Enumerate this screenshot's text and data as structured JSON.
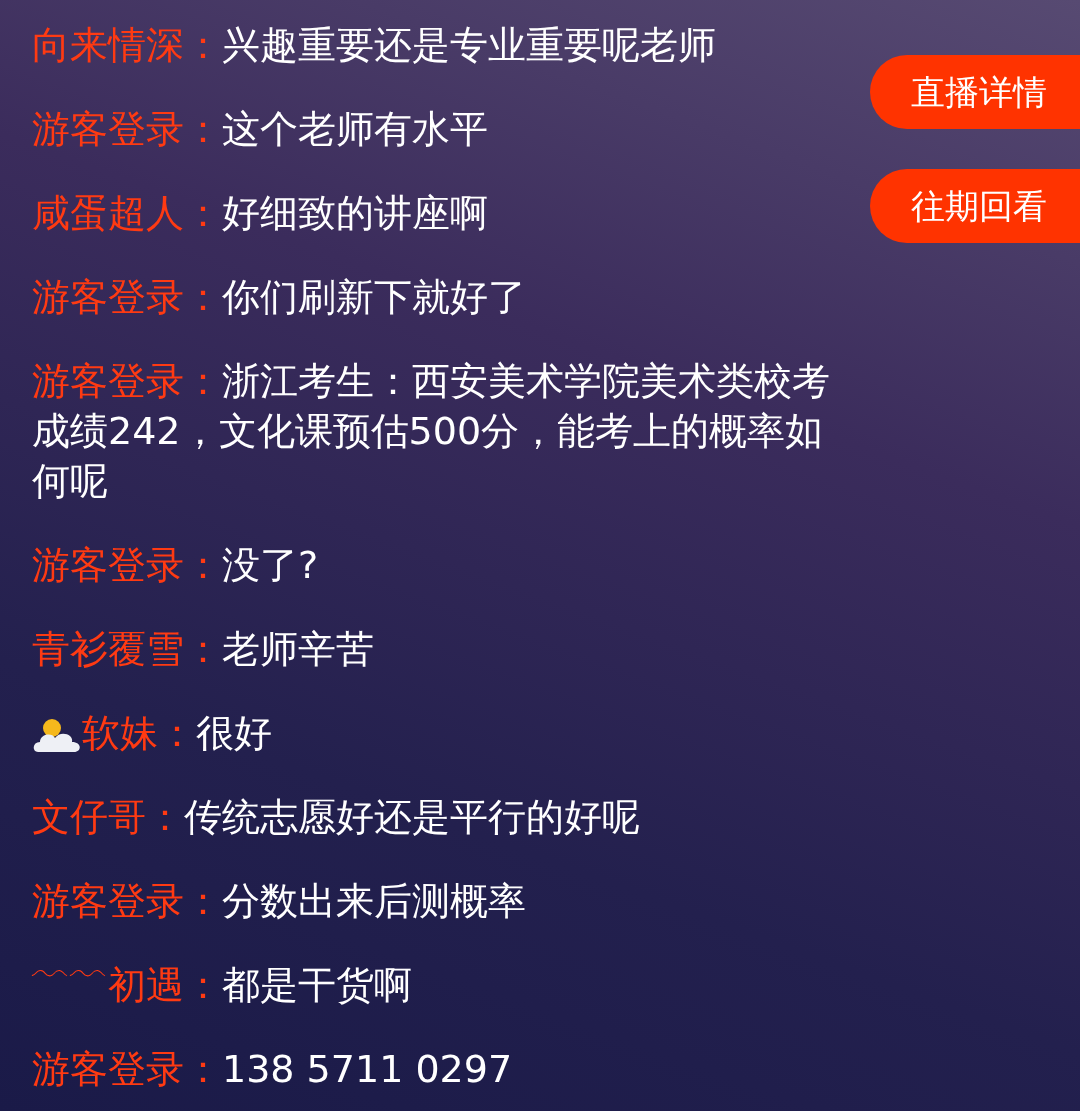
{
  "messages": [
    {
      "user": "向来情深：",
      "text": "兴趣重要还是专业重要呢老师",
      "has_icon": false
    },
    {
      "user": "游客登录：",
      "text": "这个老师有水平",
      "has_icon": false
    },
    {
      "user": "咸蛋超人：",
      "text": "好细致的讲座啊",
      "has_icon": false
    },
    {
      "user": "游客登录：",
      "text": "你们刷新下就好了",
      "has_icon": false
    },
    {
      "user": "游客登录：",
      "text": "浙江考生：西安美术学院美术类校考成绩242，文化课预估500分，能考上的概率如何呢",
      "has_icon": false
    },
    {
      "user": "游客登录：",
      "text": "没了?",
      "has_icon": false
    },
    {
      "user": "青衫覆雪：",
      "text": "老师辛苦",
      "has_icon": false
    },
    {
      "user": "软妹：",
      "text": "很好",
      "has_icon": true
    },
    {
      "user": "文仔哥：",
      "text": "传统志愿好还是平行的好呢",
      "has_icon": false
    },
    {
      "user": "游客登录：",
      "text": "分数出来后测概率",
      "has_icon": false
    },
    {
      "user": "﹋﹋初遇：",
      "text": "都是干货啊",
      "has_icon": false
    },
    {
      "user": "游客登录：",
      "text": "138 5711 0297",
      "has_icon": false
    }
  ],
  "buttons": [
    "直播详情",
    "往期回看"
  ]
}
